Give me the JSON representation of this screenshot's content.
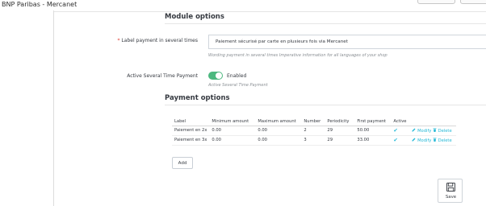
{
  "window": {
    "title": "BNP Paribas - Mercanet"
  },
  "module_options": {
    "title": "Module options",
    "label_payment": {
      "label": "Label payment in several times",
      "required_marker": "*",
      "value": "Paiement sécurisé par carte en plusieurs fois via Mercanet",
      "help": "Wording payment in several times Imperative information for all languages of your shop"
    },
    "active_several": {
      "label": "Active Several Time Payment",
      "state": "Enabled",
      "help": "Active Several Time Payment",
      "enabled": true
    }
  },
  "payment_options": {
    "title": "Payment options",
    "columns": [
      "Label",
      "Minimum amount",
      "Maximum amount",
      "Number",
      "Periodicity",
      "First payment",
      "Active"
    ],
    "rows": [
      {
        "label": "Paiement en 2x",
        "min": "0.00",
        "max": "0.00",
        "number": "2",
        "periodicity": "29",
        "first": "50.00",
        "active": "✔",
        "modify": "Modify",
        "delete": "Delete"
      },
      {
        "label": "Paiement en 3x",
        "min": "0.00",
        "max": "0.00",
        "number": "3",
        "periodicity": "29",
        "first": "33.00",
        "active": "✔",
        "modify": "Modify",
        "delete": "Delete"
      }
    ],
    "add_label": "Add"
  },
  "footer": {
    "save_label": "Save"
  },
  "colors": {
    "accent": "#25b9d7",
    "toggle_on": "#4cb87f",
    "required": "#e0352b"
  },
  "icons": {
    "modify": "pencil-icon",
    "delete": "trash-icon",
    "save": "floppy-disk-icon"
  }
}
